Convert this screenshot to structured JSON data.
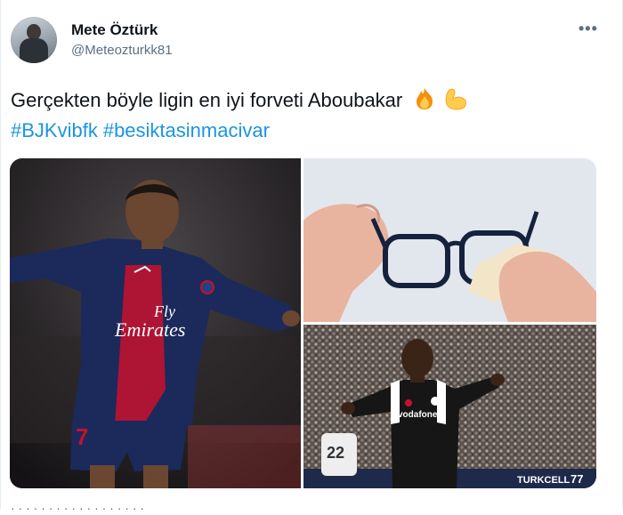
{
  "tweet": {
    "author_name": "Mete Öztürk",
    "author_handle": "@Meteozturkk81",
    "more_label": "•••",
    "text": "Gerçekten böyle ligin en iyi forveti Aboubakar",
    "emojis": [
      "fire-emoji",
      "flexed-biceps-emoji"
    ],
    "hashtags": [
      "#BJKvibfk",
      "#besiktasinmacivar"
    ],
    "footer": "· · · · · · · · · · · · · · · · · ·"
  },
  "media": {
    "photo1": {
      "shirt_text_1": "Fly",
      "shirt_text_2": "Emirates",
      "number": "7"
    },
    "photo3": {
      "shirt_text": "vodafone",
      "bg_number": "22",
      "board_text": "TURKCELL",
      "board_text_2": "77"
    }
  },
  "colors": {
    "link": "#1b95e0",
    "secondary_text": "#5b7083",
    "psg_navy": "#1b2a5b",
    "psg_red": "#c8102e"
  }
}
